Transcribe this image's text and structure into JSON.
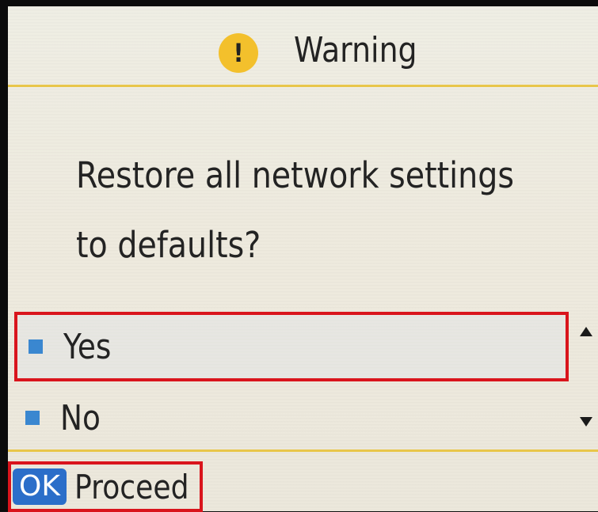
{
  "dialog": {
    "title": "Warning",
    "icon": "exclamation-icon",
    "icon_glyph": "!",
    "accent_color": "#f3c02c",
    "message": "Restore all network settings\nto defaults?"
  },
  "options": [
    {
      "label": "Yes",
      "selected": true
    },
    {
      "label": "No",
      "selected": false
    }
  ],
  "footer": {
    "ok_key": "OK",
    "ok_label": "Proceed"
  },
  "colors": {
    "highlight": "#d9141c",
    "bullet": "#3a87d0",
    "ok_key_bg": "#2b6ec9",
    "divider": "#e8c64a"
  }
}
